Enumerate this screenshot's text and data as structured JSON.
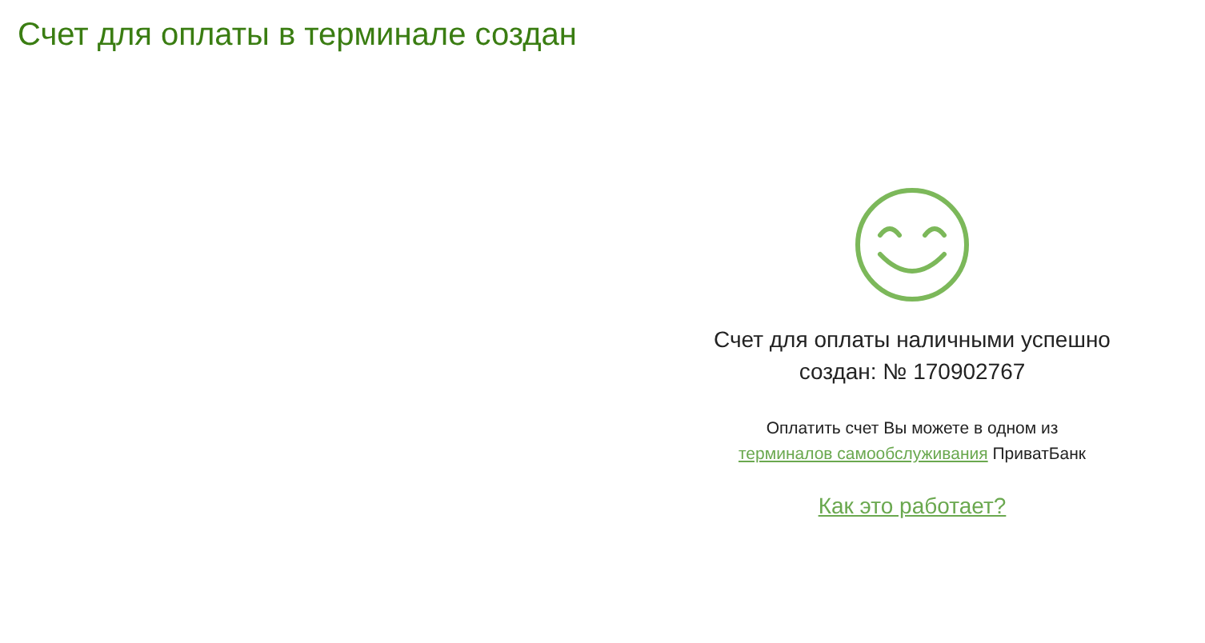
{
  "heading": "Счет для оплаты в терминале создан",
  "message": "Счет для оплаты наличными успешно создан: № 170902767",
  "note": {
    "before": "Оплатить счет Вы можете в одном из",
    "link": "терминалов самообслуживания",
    "after": "ПриватБанк"
  },
  "help_link": "Как это работает?"
}
